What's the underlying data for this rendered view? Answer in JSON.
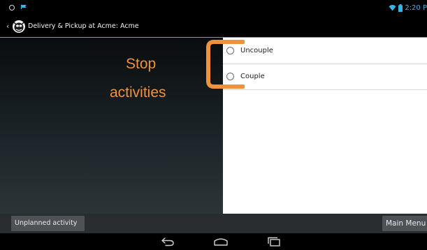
{
  "status_bar": {
    "time": "2:20 P",
    "accent_color": "#33b5e5"
  },
  "action_bar": {
    "title": "Delivery & Pickup at Acme: Acme",
    "up_caret": "‹"
  },
  "stop_options": {
    "items": [
      {
        "label": "Uncouple",
        "selected": false
      },
      {
        "label": "Couple",
        "selected": false
      }
    ]
  },
  "annotation": {
    "line1": "Stop",
    "line2": "activities",
    "color": "#f0923a"
  },
  "bottom_bar": {
    "unplanned_label": "Unplanned activity",
    "main_menu_label": "Main Menu"
  }
}
